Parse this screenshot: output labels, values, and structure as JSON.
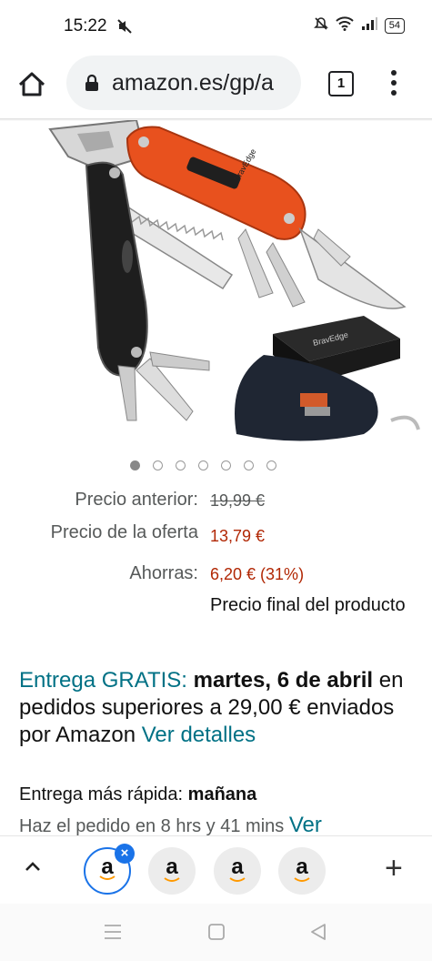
{
  "status_bar": {
    "time": "15:22",
    "battery": "54"
  },
  "browser": {
    "url": "amazon.es/gp/a",
    "tab_count": "1"
  },
  "carousel": {
    "count": 7,
    "active_index": 0
  },
  "product_image": {
    "brand_text": "BravEdge"
  },
  "pricing": {
    "previous_label": "Precio anterior:",
    "previous_value": "19,99 €",
    "offer_label": "Precio de la oferta",
    "offer_value": "13,79 €",
    "savings_label": "Ahorras:",
    "savings_value": "6,20 € (31%)",
    "final_note": "Precio final del producto"
  },
  "delivery": {
    "free_label": "Entrega GRATIS:",
    "date": "martes, 6 de abril",
    "condition": " en pedidos superiores a 29,00 € enviados por Amazon ",
    "details_link": "Ver detalles",
    "faster_label": "Entrega más rápida: ",
    "faster_value": "mañana",
    "order_text": "Haz el pedido en 8 hrs y 41 mins ",
    "order_link": "Ver"
  },
  "tabs": {
    "glyph": "a",
    "count": 4
  },
  "colors": {
    "price_red": "#b12704",
    "link_teal": "#007185",
    "accent_blue": "#1a73e8"
  }
}
